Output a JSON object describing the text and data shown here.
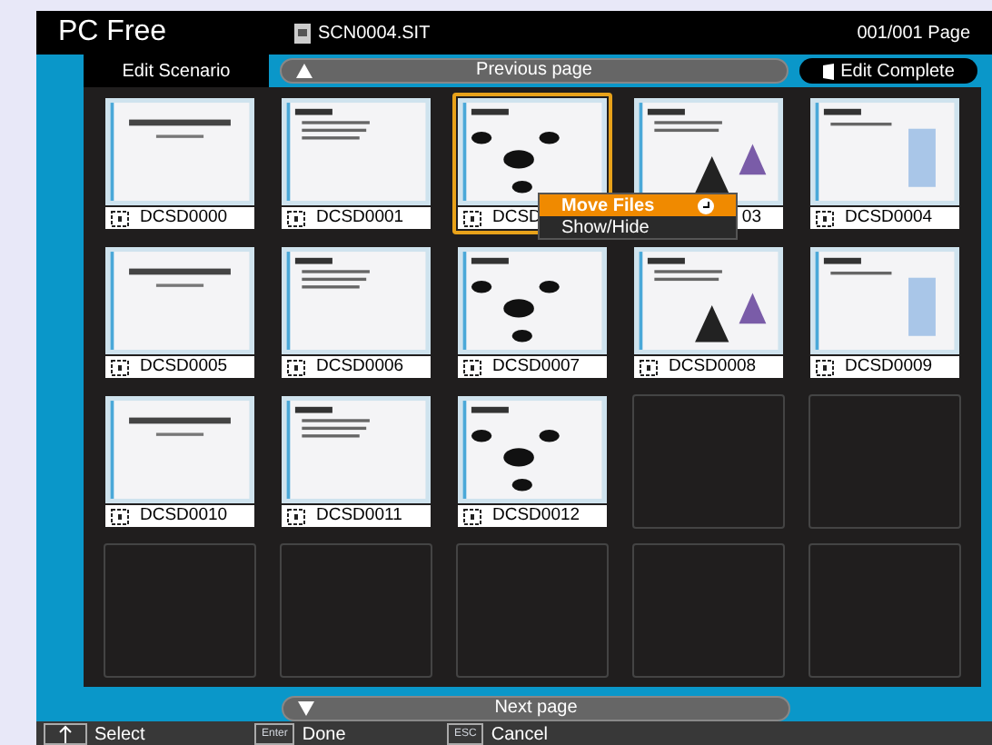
{
  "title_bar": {
    "app": "PC Free",
    "file": "SCN0004.SIT",
    "page": "001/001 Page"
  },
  "tabs": [
    {
      "label": "Edit Scenario",
      "selected": true
    }
  ],
  "previous_button": {
    "label": "Previous page"
  },
  "complete_button": {
    "label": "Edit Complete"
  },
  "cells": [
    {
      "kind": "slide",
      "label": "DCSD0000",
      "camera_icon": true,
      "selected": false
    },
    {
      "kind": "slide",
      "label": "DCSD0001",
      "camera_icon": true,
      "selected": false
    },
    {
      "kind": "slide",
      "label": "DCSD",
      "camera_icon": true,
      "selected": true
    },
    {
      "kind": "slide",
      "label": "03",
      "camera_icon": false,
      "selected": false
    },
    {
      "kind": "slide",
      "label": "DCSD0004",
      "camera_icon": true,
      "selected": false
    },
    {
      "kind": "slide",
      "label": "DCSD0005",
      "camera_icon": true,
      "selected": false
    },
    {
      "kind": "slide",
      "label": "DCSD0006",
      "camera_icon": true,
      "selected": false
    },
    {
      "kind": "slide",
      "label": "DCSD0007",
      "camera_icon": true,
      "selected": false
    },
    {
      "kind": "slide",
      "label": "DCSD0008",
      "camera_icon": true,
      "selected": false
    },
    {
      "kind": "slide",
      "label": "DCSD0009",
      "camera_icon": true,
      "selected": false
    },
    {
      "kind": "slide",
      "label": "DCSD0010",
      "camera_icon": true,
      "selected": false
    },
    {
      "kind": "slide",
      "label": "DCSD0011",
      "camera_icon": true,
      "selected": false
    },
    {
      "kind": "slide",
      "label": "DCSD0012",
      "camera_icon": true,
      "selected": false
    },
    {
      "kind": "empty"
    },
    {
      "kind": "empty"
    },
    {
      "kind": "empty"
    },
    {
      "kind": "empty"
    },
    {
      "kind": "empty"
    },
    {
      "kind": "empty"
    },
    {
      "kind": "empty"
    }
  ],
  "context_menu": {
    "items": [
      {
        "label": "Move Files",
        "selected": true
      },
      {
        "label": "Show/Hide",
        "selected": false
      }
    ]
  },
  "next_button": {
    "label": "Next page"
  },
  "footer": [
    {
      "label": "Select",
      "kind": "arrow"
    },
    {
      "key": "Enter",
      "label": "Done",
      "kind": "text"
    },
    {
      "key": "ESC",
      "label": "Cancel",
      "kind": "text"
    }
  ]
}
